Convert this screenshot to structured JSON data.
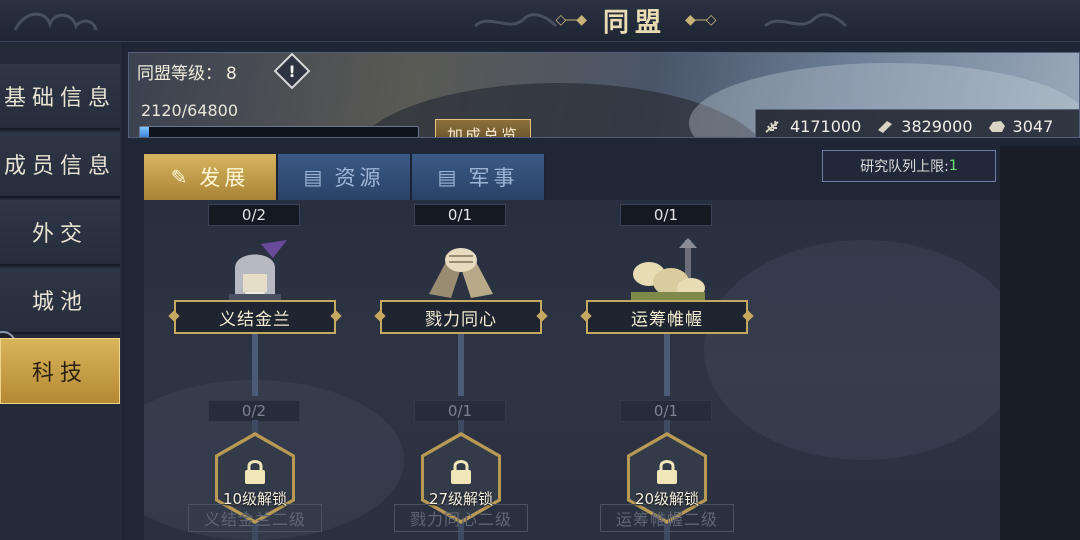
{
  "header": {
    "title": "同盟"
  },
  "sidebar": {
    "items": [
      {
        "label": "基础信息"
      },
      {
        "label": "成员信息"
      },
      {
        "label": "外交"
      },
      {
        "label": "城池"
      },
      {
        "label": "科技"
      }
    ],
    "active_index": 4
  },
  "alliance": {
    "level_label": "同盟等级：",
    "level": "8",
    "warning_icon": "!",
    "exp_text": "2120/64800",
    "exp_progress": 0.033,
    "bonus_button": "加成总览"
  },
  "resources": [
    {
      "icon": "grain-icon",
      "value": "4171000"
    },
    {
      "icon": "wood-icon",
      "value": "3829000"
    },
    {
      "icon": "stone-icon",
      "value": "3047"
    }
  ],
  "tabs": [
    {
      "label": "发展",
      "icon": "scroll-icon"
    },
    {
      "label": "资源",
      "icon": "book-icon"
    },
    {
      "label": "军事",
      "icon": "book-icon"
    }
  ],
  "active_tab": 0,
  "research_queue": {
    "label": "研究队列上限:",
    "value": "1"
  },
  "tech_nodes": [
    {
      "count": "0/2",
      "name": "义结金兰",
      "next_count": "0/2",
      "unlock": "10级解锁",
      "next_name": "义结金兰二级"
    },
    {
      "count": "0/1",
      "name": "戮力同心",
      "next_count": "0/1",
      "unlock": "27级解锁",
      "next_name": "戮力同心二级"
    },
    {
      "count": "0/1",
      "name": "运筹帷幄",
      "next_count": "0/1",
      "unlock": "20级解锁",
      "next_name": "运筹帷幄二级"
    }
  ],
  "colors": {
    "gold_accent": "#c7a860",
    "tab_active": "#d8b660",
    "tab_inactive": "#3a5a86",
    "queue_number": "#6ee07a"
  }
}
